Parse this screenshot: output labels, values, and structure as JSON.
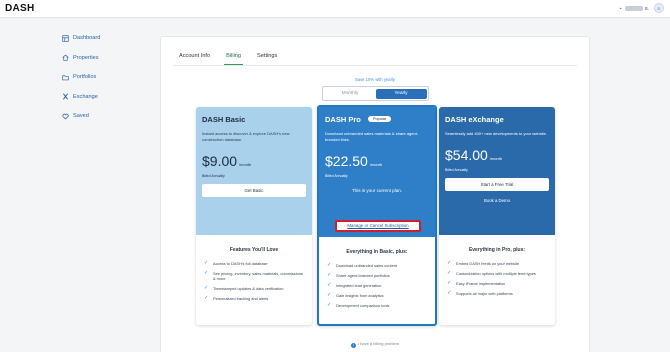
{
  "app": {
    "logo": "DASH"
  },
  "user": {
    "initial_suffix": "S.",
    "avatar_letter": "D"
  },
  "sidebar": {
    "items": [
      {
        "label": "Dashboard",
        "icon": "dashboard-icon"
      },
      {
        "label": "Properties",
        "icon": "home-icon"
      },
      {
        "label": "Portfolios",
        "icon": "folder-icon"
      },
      {
        "label": "Exchange",
        "icon": "exchange-icon"
      },
      {
        "label": "Saved",
        "icon": "heart-icon"
      }
    ]
  },
  "tabs": [
    {
      "label": "Account Info",
      "active": false
    },
    {
      "label": "Billing",
      "active": true
    },
    {
      "label": "Settings",
      "active": false
    }
  ],
  "billing": {
    "promo": "Save 10% with yearly",
    "toggle": {
      "monthly": "Monthly",
      "yearly": "Yearly",
      "selected": "Yearly"
    }
  },
  "plans": [
    {
      "name": "DASH Basic",
      "description": "Instant access to discover & explore DASH's new construction database.",
      "price": "$9.00",
      "period": "/month",
      "billed": "Billed Annually",
      "button": "Get Basic",
      "features_title": "Features You'll Love",
      "features": [
        "Access to DASH's full database",
        "See pricing, inventory, sales materials, commissions & more",
        "Timestamped updates & data verification",
        "Personalized tracking and alerts"
      ],
      "color": "#a9d1ec"
    },
    {
      "name": "DASH Pro",
      "badge": "Popular",
      "description": "Download unbranded sales materials & share agent-branded links.",
      "price": "$22.50",
      "period": "/month",
      "billed": "Billed Annually",
      "current_text": "This is your current plan.",
      "manage_link": "Manage or Cancel Subscription",
      "features_title": "Everything in Basic, plus:",
      "features": [
        "Download unbranded sales content",
        "Share agent-branded portfolios",
        "Integrated lead generation",
        "Gain insights from analytics",
        "Development comparison tools"
      ],
      "color": "#2e7fc7"
    },
    {
      "name": "DASH eXchange",
      "description": "Seamlessly add 400+ new developments to your website.",
      "price": "$54.00",
      "period": "/month",
      "billed": "Billed Annually",
      "button": "Start a Free Trial",
      "secondary_link": "Book a Demo",
      "features_title": "Everything in Pro, plus:",
      "features": [
        "Embed DASH feeds on your website",
        "Customization options with multiple feed types",
        "Easy iFrame implementation",
        "Supports all major web platforms"
      ],
      "color": "#2a6aab"
    }
  ],
  "footer": {
    "billing_problem": "I have a billing problem"
  }
}
